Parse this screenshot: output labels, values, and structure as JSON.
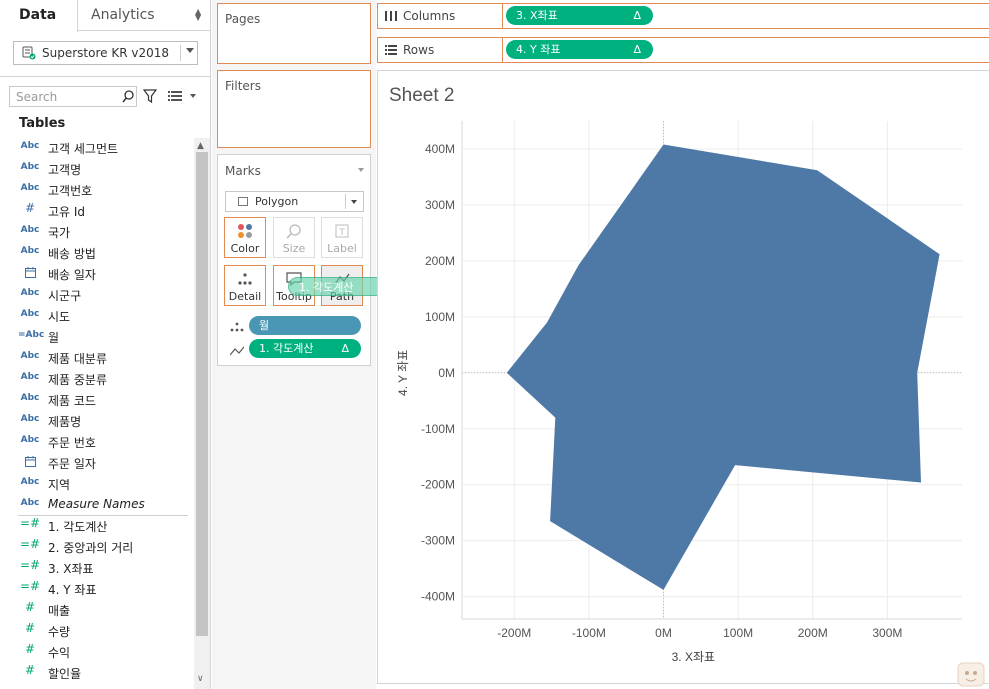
{
  "tabs": {
    "data": "Data",
    "analytics": "Analytics"
  },
  "datasource": {
    "name": "Superstore KR v2018"
  },
  "search": {
    "placeholder": "Search"
  },
  "tables_header": "Tables",
  "fields": [
    {
      "type": "Abc",
      "name": "고객 세그먼트",
      "kind": "dim"
    },
    {
      "type": "Abc",
      "name": "고객명",
      "kind": "dim"
    },
    {
      "type": "Abc",
      "name": "고객번호",
      "kind": "dim"
    },
    {
      "type": "#",
      "name": "고유 Id",
      "kind": "dimnum"
    },
    {
      "type": "Abc",
      "name": "국가",
      "kind": "dim"
    },
    {
      "type": "Abc",
      "name": "배송 방법",
      "kind": "dim"
    },
    {
      "type": "date",
      "name": "배송 일자",
      "kind": "date"
    },
    {
      "type": "Abc",
      "name": "시군구",
      "kind": "dim"
    },
    {
      "type": "Abc",
      "name": "시도",
      "kind": "dim"
    },
    {
      "type": "=Abc",
      "name": "월",
      "kind": "calc"
    },
    {
      "type": "Abc",
      "name": "제품 대분류",
      "kind": "dim"
    },
    {
      "type": "Abc",
      "name": "제품 중분류",
      "kind": "dim"
    },
    {
      "type": "Abc",
      "name": "제품 코드",
      "kind": "dim"
    },
    {
      "type": "Abc",
      "name": "제품명",
      "kind": "dim"
    },
    {
      "type": "Abc",
      "name": "주문 번호",
      "kind": "dim"
    },
    {
      "type": "date",
      "name": "주문 일자",
      "kind": "date"
    },
    {
      "type": "Abc",
      "name": "지역",
      "kind": "dim"
    },
    {
      "type": "Abc",
      "name": "Measure Names",
      "kind": "italic"
    },
    {
      "type": "=#",
      "name": "1. 각도계산",
      "kind": "meascalc"
    },
    {
      "type": "=#",
      "name": "2. 중앙과의 거리",
      "kind": "meascalc"
    },
    {
      "type": "=#",
      "name": "3. X좌표",
      "kind": "meascalc"
    },
    {
      "type": "=#",
      "name": "4. Y 좌표",
      "kind": "meascalc"
    },
    {
      "type": "#",
      "name": "매출",
      "kind": "meas"
    },
    {
      "type": "#",
      "name": "수량",
      "kind": "meas"
    },
    {
      "type": "#",
      "name": "수익",
      "kind": "meas"
    },
    {
      "type": "#",
      "name": "할인율",
      "kind": "meas"
    }
  ],
  "shelves": {
    "pages": "Pages",
    "filters": "Filters",
    "columns_label": "Columns",
    "rows_label": "Rows",
    "columns_pill": "3. X좌표",
    "rows_pill": "4. Y 좌표",
    "delta": "Δ"
  },
  "marks": {
    "title": "Marks",
    "type": "Polygon",
    "buttons": {
      "color": "Color",
      "size": "Size",
      "label": "Label",
      "detail": "Detail",
      "tooltip": "Tooltip",
      "path": "Path"
    },
    "detail_pill": "월",
    "path_pill": "1. 각도계산",
    "drag_pill": "1. 각도계산"
  },
  "sheet": {
    "title": "Sheet 2"
  },
  "colors": {
    "polygon": "#4e79a7",
    "pill_green": "#00b180",
    "pill_blue": "#4a96b5",
    "shelf_border": "#e28a56"
  },
  "chart_data": {
    "type": "polygon",
    "title": "Sheet 2",
    "xlabel": "3. X좌표",
    "ylabel": "4. Y 좌표",
    "xlim": [
      -270,
      400
    ],
    "ylim": [
      -440,
      450
    ],
    "xticks": [
      -200,
      -100,
      0,
      100,
      200,
      300
    ],
    "xtick_labels": [
      "-200M",
      "-100M",
      "0M",
      "100M",
      "200M",
      "300M"
    ],
    "yticks": [
      400,
      300,
      200,
      100,
      0,
      -100,
      -200,
      -300,
      -400
    ],
    "ytick_labels": [
      "400M",
      "300M",
      "200M",
      "100M",
      "0M",
      "-100M",
      "-200M",
      "-300M",
      "-400M"
    ],
    "grid": true,
    "unit": "M",
    "points": [
      {
        "x": 0,
        "y": 408
      },
      {
        "x": 206,
        "y": 362
      },
      {
        "x": 370,
        "y": 212
      },
      {
        "x": 340,
        "y": 0
      },
      {
        "x": 345,
        "y": -196
      },
      {
        "x": 96,
        "y": -165
      },
      {
        "x": 0,
        "y": -388
      },
      {
        "x": -152,
        "y": -265
      },
      {
        "x": -145,
        "y": -80
      },
      {
        "x": -210,
        "y": 0
      },
      {
        "x": -156,
        "y": 90
      },
      {
        "x": -114,
        "y": 192
      }
    ]
  }
}
